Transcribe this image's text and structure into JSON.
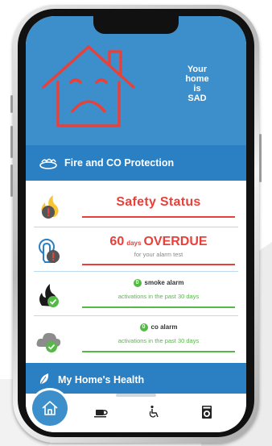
{
  "hero": {
    "status_lines": [
      "Your",
      "home",
      "is",
      "SAD"
    ],
    "background": "#3c8fcb",
    "house_color": "#e8403a"
  },
  "fire_section": {
    "title": "Fire and CO Protection",
    "icon": "smoke-detector-icon"
  },
  "rows": {
    "safety": {
      "title": "Safety Status",
      "icon": "fire-warning-icon"
    },
    "overdue": {
      "days": "60",
      "days_word": "days",
      "status": "OVERDUE",
      "subtitle": "for your alarm test",
      "icon": "alarm-test-icon"
    },
    "smoke": {
      "count": "0",
      "label": "smoke alarm",
      "subtitle": "activations in the past 30 days",
      "icon": "smoke-flame-icon"
    },
    "co": {
      "count": "0",
      "label": "co alarm",
      "subtitle": "activations in the past 30 days",
      "icon": "co-cloud-icon"
    }
  },
  "health_section": {
    "title": "My Home's Health",
    "icon": "leaf-icon"
  },
  "tabbar": {
    "items": [
      "home-icon",
      "coffee-icon",
      "accessibility-icon",
      "appliance-icon"
    ]
  },
  "colors": {
    "accent_blue": "#2b80c4",
    "alert_red": "#e8403a",
    "ok_green": "#55b847"
  }
}
